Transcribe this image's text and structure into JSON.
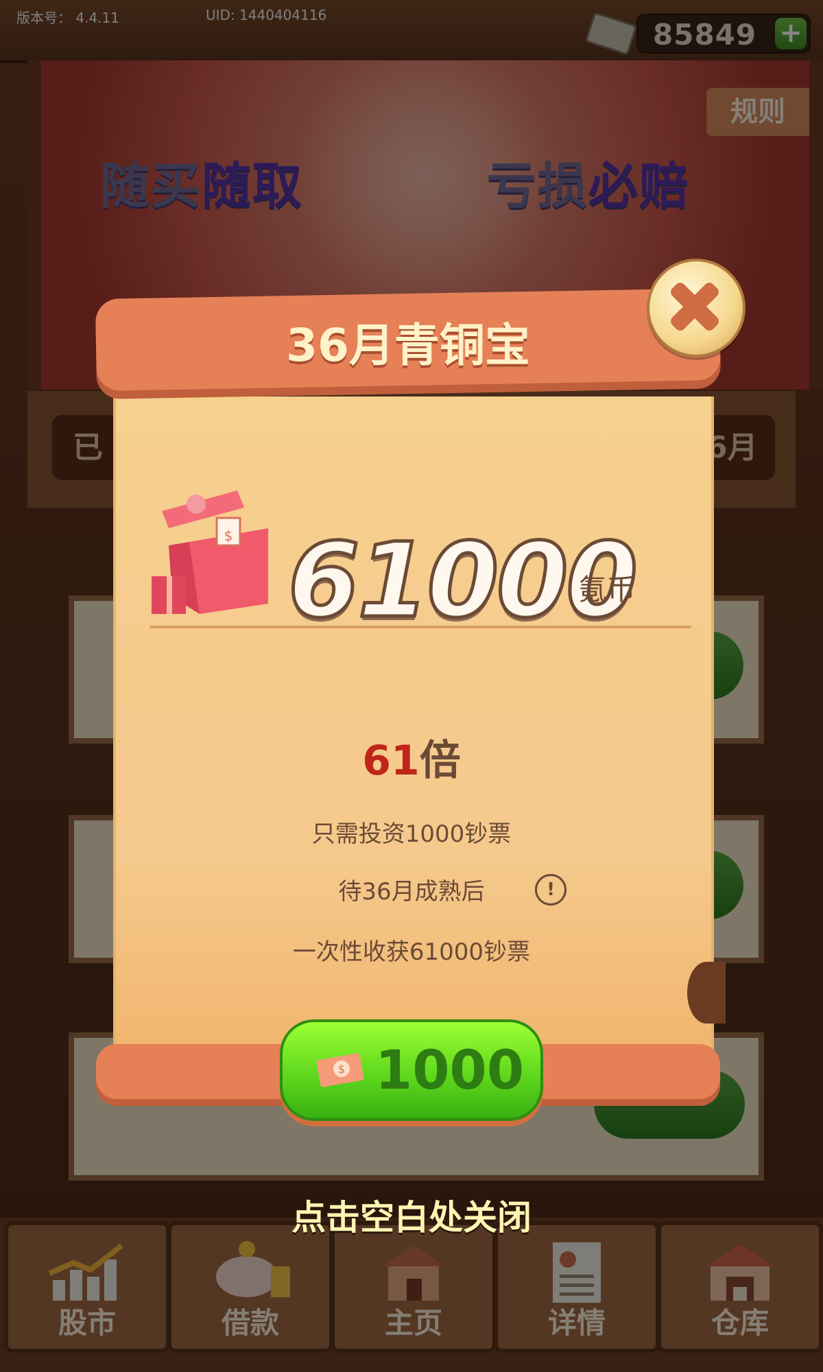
{
  "status": {
    "version_label": "版本号：",
    "version_value": "4.4.11",
    "uid": "UID: 1440404116",
    "coins": "85849",
    "add_symbol": "+"
  },
  "banner": {
    "rule": "规则",
    "slogan_part1": "随买",
    "slogan_part1_strong": "随取",
    "slogan_part2": "亏损",
    "slogan_part2_strong": "必赔"
  },
  "tabs": {
    "left_partial": "已",
    "right_partial": "6月"
  },
  "modal": {
    "title": "36月青铜宝",
    "amount": "61000",
    "amount_unit": "氪币",
    "multiplier_num": "61",
    "multiplier_suffix": "倍",
    "line1": "只需投资1000钞票",
    "line2": "待36月成熟后",
    "line3": "一次性收获61000钞票",
    "info_symbol": "!",
    "price": "1000",
    "close_icon": "close-icon",
    "tap_to_close": "点击空白处关闭"
  },
  "nav": [
    {
      "label": "股市",
      "icon": "stock-chart-icon"
    },
    {
      "label": "借款",
      "icon": "piggy-bank-icon"
    },
    {
      "label": "主页",
      "icon": "home-icon"
    },
    {
      "label": "详情",
      "icon": "document-icon"
    },
    {
      "label": "仓库",
      "icon": "warehouse-icon"
    }
  ],
  "colors": {
    "accent_green": "#60d81d",
    "title_orange": "#e68057",
    "paper": "#f5c98c",
    "multiplier_red": "#c0251a"
  }
}
